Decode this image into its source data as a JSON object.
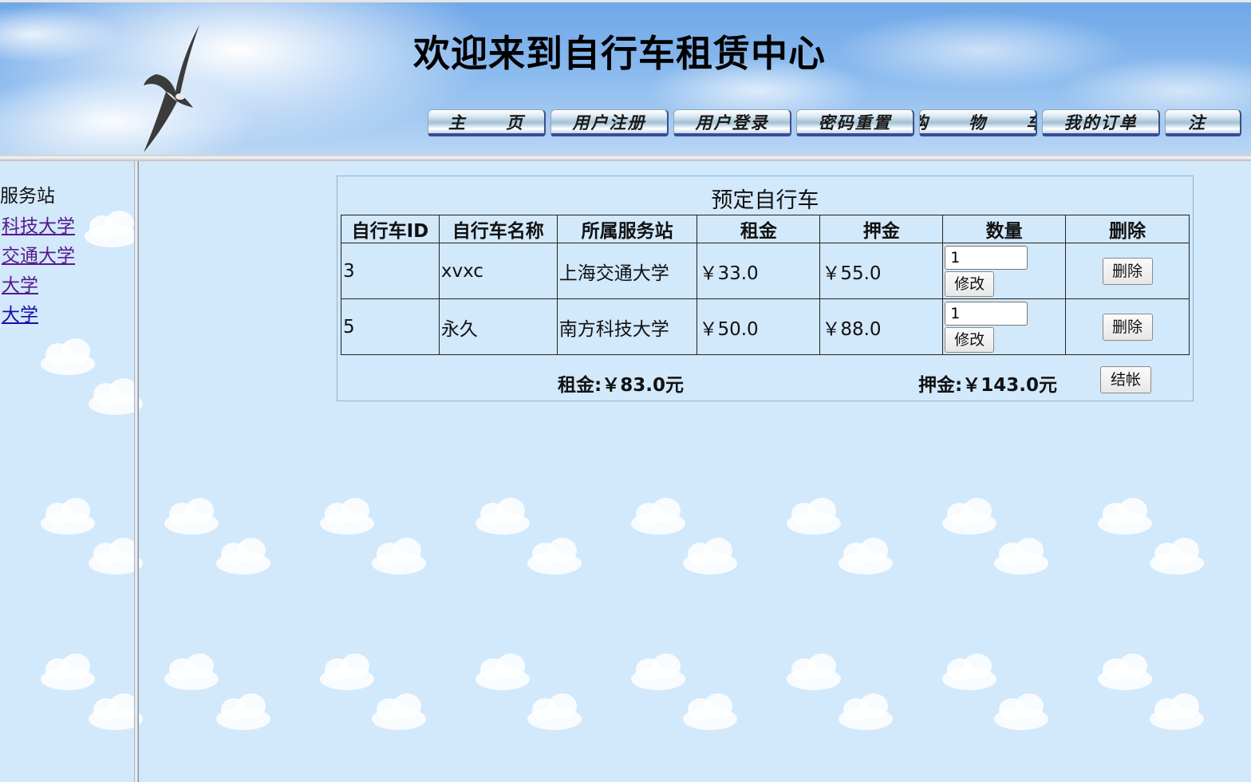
{
  "header": {
    "title": "欢迎来到自行车租赁中心",
    "nav": [
      {
        "label": "主 页"
      },
      {
        "label": "用户注册"
      },
      {
        "label": "用户登录"
      },
      {
        "label": "密码重置"
      },
      {
        "label": "购 物 车"
      },
      {
        "label": "我的订单"
      },
      {
        "label": "注"
      }
    ]
  },
  "sidebar": {
    "heading": "服务站",
    "links": [
      {
        "label": "科技大学"
      },
      {
        "label": "交通大学"
      },
      {
        "label": "大学"
      },
      {
        "label": "大学"
      }
    ]
  },
  "cart": {
    "caption": "预定自行车",
    "columns": [
      "自行车ID",
      "自行车名称",
      "所属服务站",
      "租金",
      "押金",
      "数量",
      "删除"
    ],
    "rows": [
      {
        "id": "3",
        "name": "xvxc",
        "station": "上海交通大学",
        "rent": "￥33.0",
        "deposit": "￥55.0",
        "quantity": "1",
        "modify_label": "修改",
        "delete_label": "删除"
      },
      {
        "id": "5",
        "name": "永久",
        "station": "南方科技大学",
        "rent": "￥50.0",
        "deposit": "￥88.0",
        "quantity": "1",
        "modify_label": "修改",
        "delete_label": "删除"
      }
    ],
    "total_rent": "租金:￥83.0元",
    "total_deposit": "押金:￥143.0元",
    "checkout_label": "结帐"
  },
  "colors": {
    "page_background": "#d2e8fb",
    "panel_border": "#8db3cf",
    "nav_underline": "#3b4a9a"
  }
}
